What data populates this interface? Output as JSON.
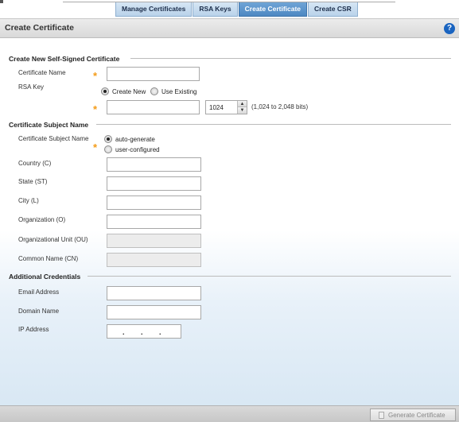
{
  "tabs": [
    {
      "label": "Manage Certificates"
    },
    {
      "label": "RSA Keys"
    },
    {
      "label": "Create Certificate"
    },
    {
      "label": "Create CSR"
    }
  ],
  "active_tab": "Create Certificate",
  "header": {
    "title": "Create Certificate",
    "help": "?"
  },
  "self_signed": {
    "section_title": "Create New Self-Signed Certificate",
    "cert_name_label": "Certificate Name",
    "cert_name_value": "",
    "rsa_key_label": "RSA Key",
    "rsa_options": {
      "create_new": "Create New",
      "use_existing": "Use Existing"
    },
    "rsa_selected": "Create New",
    "key_name_value": "",
    "key_size_value": "1024",
    "key_size_hint": "(1,024 to 2,048 bits)"
  },
  "subject": {
    "section_title": "Certificate Subject Name",
    "subject_label": "Certificate Subject Name",
    "options": {
      "auto": "auto-generate",
      "user": "user-configured"
    },
    "selected": "auto-generate",
    "country_label": "Country (C)",
    "state_label": "State (ST)",
    "city_label": "City (L)",
    "org_label": "Organization (O)",
    "org_unit_label": "Organizational Unit (OU)",
    "common_name_label": "Common Name (CN)"
  },
  "credentials": {
    "section_title": "Additional Credentials",
    "email_label": "Email Address",
    "domain_label": "Domain Name",
    "ip_label": "IP Address"
  },
  "footer": {
    "generate_label": "Generate Certificate"
  },
  "colors": {
    "required_star": "#f49b17",
    "active_tab": "#4d88c2",
    "help": "#1a64c0"
  }
}
